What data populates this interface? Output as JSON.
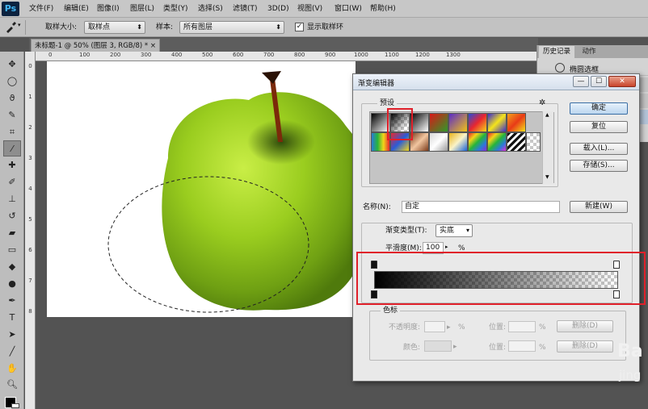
{
  "app": {
    "logo": "Ps"
  },
  "menu": [
    "文件(F)",
    "编辑(E)",
    "图像(I)",
    "图层(L)",
    "类型(Y)",
    "选择(S)",
    "滤镜(T)",
    "3D(D)",
    "视图(V)",
    "窗口(W)",
    "帮助(H)"
  ],
  "options_bar": {
    "tool_icon": "eyedropper-icon",
    "sample_size_label": "取样大小:",
    "sample_size_value": "取样点",
    "sample_label": "样本:",
    "sample_value": "所有图层",
    "show_ring_label": "显示取样环",
    "show_ring_checked": true
  },
  "document": {
    "tab_title": "未标题-1 @ 50% (图层 3, RGB/8) *",
    "close_glyph": "×"
  },
  "ruler": {
    "top_ticks": [
      "0",
      "100",
      "200",
      "300",
      "400",
      "500",
      "600",
      "700",
      "800",
      "900",
      "1000",
      "1100",
      "1200",
      "1300"
    ],
    "left_ticks": [
      "0",
      "1",
      "2",
      "3",
      "4",
      "5",
      "6",
      "7",
      "8"
    ]
  },
  "history_panel": {
    "tabs": [
      "历史记录",
      "动作"
    ],
    "item": "椭圆选框"
  },
  "gradient_editor": {
    "title": "渐变编辑器",
    "presets_label": "预设",
    "gear_glyph": "✲",
    "buttons": {
      "ok": "确定",
      "reset": "复位",
      "load": "载入(L)...",
      "save": "存储(S)...",
      "new": "新建(W)"
    },
    "name_label": "名称(N):",
    "name_value": "自定",
    "type_label": "渐变类型(T):",
    "type_value": "实底",
    "smooth_label": "平滑度(M):",
    "smooth_value": "100",
    "smooth_unit": "%",
    "stops_group": "色标",
    "opacity_label": "不透明度:",
    "opacity_unit": "%",
    "position_label": "位置:",
    "position_unit": "%",
    "delete_label": "删除(D)",
    "color_label": "颜色:",
    "win_min": "—",
    "win_max": "☐",
    "win_close": "✕"
  },
  "watermark": {
    "line1": "Ba",
    "line2": "jing"
  },
  "colors": {
    "highlight_red": "#e0202a",
    "apple_green": "#9acd1f"
  }
}
